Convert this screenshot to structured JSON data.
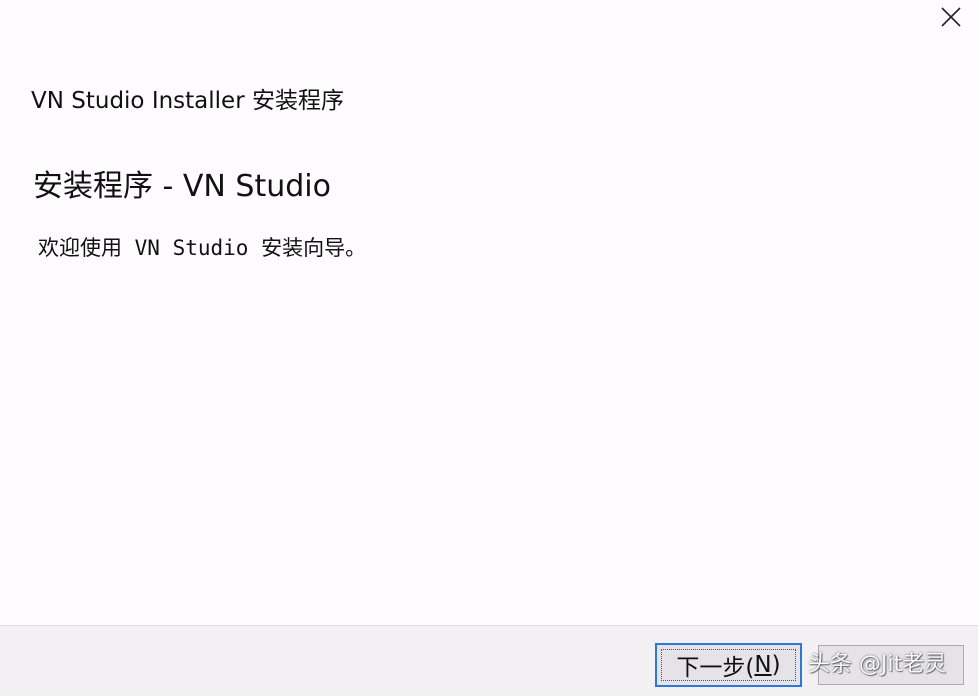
{
  "window": {
    "title": "VN Studio Installer 安装程序"
  },
  "page": {
    "heading": "安装程序 - VN Studio",
    "welcome": "欢迎使用 VN Studio 安装向导。"
  },
  "footer": {
    "next_label": "下一步(",
    "next_mnemonic": "N",
    "next_suffix": ")",
    "watermark": "头条 @Jit老灵"
  },
  "icons": {
    "close": "close-icon"
  },
  "colors": {
    "background": "#fefcfe",
    "footer_background": "#f2f0f2",
    "focus_border": "#2b79d6",
    "button_face": "#e5e3e8"
  }
}
